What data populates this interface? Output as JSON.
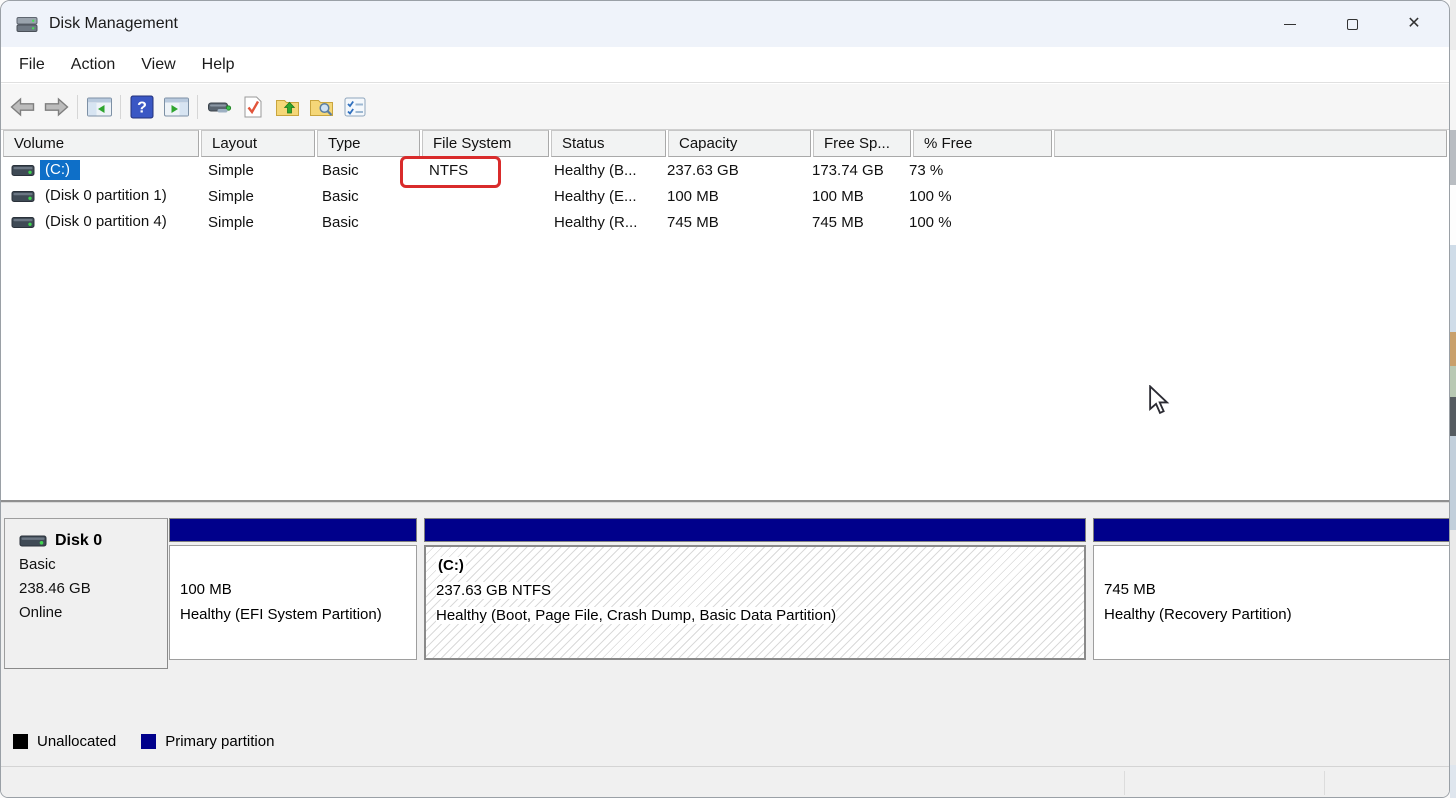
{
  "window": {
    "title": "Disk Management",
    "controls": {
      "minimize": "minimize",
      "maximize": "maximize",
      "close": "✕"
    }
  },
  "menu": {
    "items": [
      "File",
      "Action",
      "View",
      "Help"
    ]
  },
  "toolbar": {
    "icons": [
      "back",
      "forward",
      "show-console-tree",
      "help",
      "show-action-pane",
      "disk-tool",
      "check-document",
      "folder-up",
      "folder-search",
      "checklist"
    ]
  },
  "volume_list": {
    "columns": [
      "Volume",
      "Layout",
      "Type",
      "File System",
      "Status",
      "Capacity",
      "Free Sp...",
      "% Free"
    ],
    "rows": [
      {
        "volume": "(C:)",
        "layout": "Simple",
        "type": "Basic",
        "file_system": "NTFS",
        "status": "Healthy (B...",
        "capacity": "237.63 GB",
        "free_space": "173.74 GB",
        "pct_free": "73 %",
        "selected": true
      },
      {
        "volume": "(Disk 0 partition 1)",
        "layout": "Simple",
        "type": "Basic",
        "file_system": "",
        "status": "Healthy (E...",
        "capacity": "100 MB",
        "free_space": "100 MB",
        "pct_free": "100 %",
        "selected": false
      },
      {
        "volume": "(Disk 0 partition 4)",
        "layout": "Simple",
        "type": "Basic",
        "file_system": "",
        "status": "Healthy (R...",
        "capacity": "745 MB",
        "free_space": "745 MB",
        "pct_free": "100 %",
        "selected": false
      }
    ]
  },
  "annotation": {
    "highlighted_value": "NTFS",
    "color": "#d92b2b"
  },
  "disk_view": {
    "disk": {
      "name": "Disk 0",
      "type": "Basic",
      "size": "238.46 GB",
      "status": "Online"
    },
    "partitions": [
      {
        "name": "",
        "size": "100 MB",
        "status": "Healthy (EFI System Partition)",
        "selected": false
      },
      {
        "name": "(C:)",
        "size": "237.63 GB NTFS",
        "status": "Healthy (Boot, Page File, Crash Dump, Basic Data Partition)",
        "selected": true
      },
      {
        "name": "",
        "size": "745 MB",
        "status": "Healthy (Recovery Partition)",
        "selected": false
      }
    ]
  },
  "legend": {
    "items": [
      {
        "label": "Unallocated",
        "color": "#000000"
      },
      {
        "label": "Primary partition",
        "color": "#00008b"
      }
    ]
  },
  "colors": {
    "partition_header_navy": "#00008b",
    "selection_blue": "#0e6fc8",
    "annotation_red": "#d92b2b",
    "titlebar_bg": "#eff3fa"
  }
}
